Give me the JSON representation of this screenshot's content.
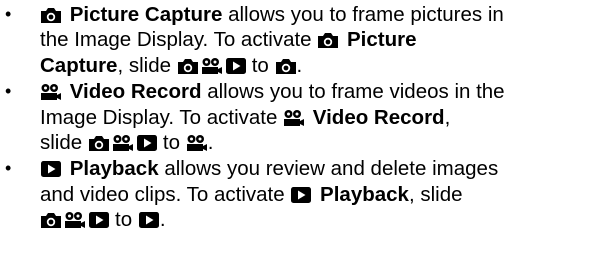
{
  "items": [
    {
      "mode_name": "Picture Capture",
      "lines": [
        {
          "a": "allows you to frame pictures in",
          "b": "the Image Display. To activate",
          "c": "Capture",
          "d": ", slide",
          "e": "to",
          "f": "."
        }
      ],
      "name_part1": "Picture",
      "name_part2": "Capture"
    },
    {
      "mode_name": "Video Record",
      "desc1": "allows you to frame videos in the",
      "desc2": "Image Display. To activate",
      "desc3": ",",
      "slide": "slide",
      "to": "to",
      "end": "."
    },
    {
      "mode_name": "Playback",
      "desc1": "allows you review and delete images",
      "desc2": "and video clips. To activate",
      "desc3": ", slide",
      "to": "to",
      "end": "."
    }
  ],
  "bullet": "•",
  "icons": {
    "camera": "camera-icon",
    "video": "video-camera-icon",
    "play": "play-icon"
  }
}
